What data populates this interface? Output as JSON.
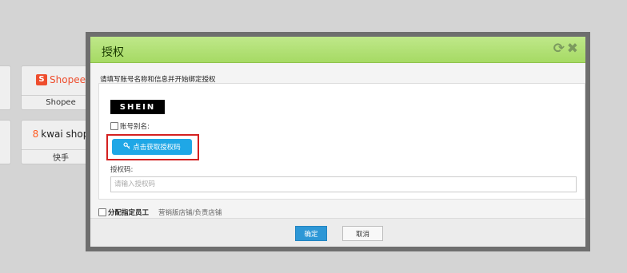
{
  "background": {
    "cards": [
      {
        "logo_text": "Shopee",
        "logo_icon": "S",
        "name": "Shopee"
      },
      {
        "logo_text": "kwai shop",
        "logo_icon": "8",
        "name": "快手"
      }
    ]
  },
  "modal": {
    "title": "授权",
    "refresh_icon": "⟳",
    "close_icon": "✖",
    "intro": "请填写账号名称和信息并开始绑定授权",
    "brand_logo": "SHEIN",
    "alias_label": "账号别名:",
    "get_code_button": "点击获取授权码",
    "code_label": "授权码:",
    "code_placeholder": "请输入授权码",
    "code_value": "",
    "assign_label": "分配指定员工",
    "assign_hint": "营销版店铺/负责店铺",
    "ok_button": "确定",
    "cancel_button": "取消"
  },
  "colors": {
    "header_green": "#a6da64",
    "primary_blue": "#1fa7e6",
    "highlight_red": "#d42020",
    "shopee_orange": "#ee4d2d"
  }
}
